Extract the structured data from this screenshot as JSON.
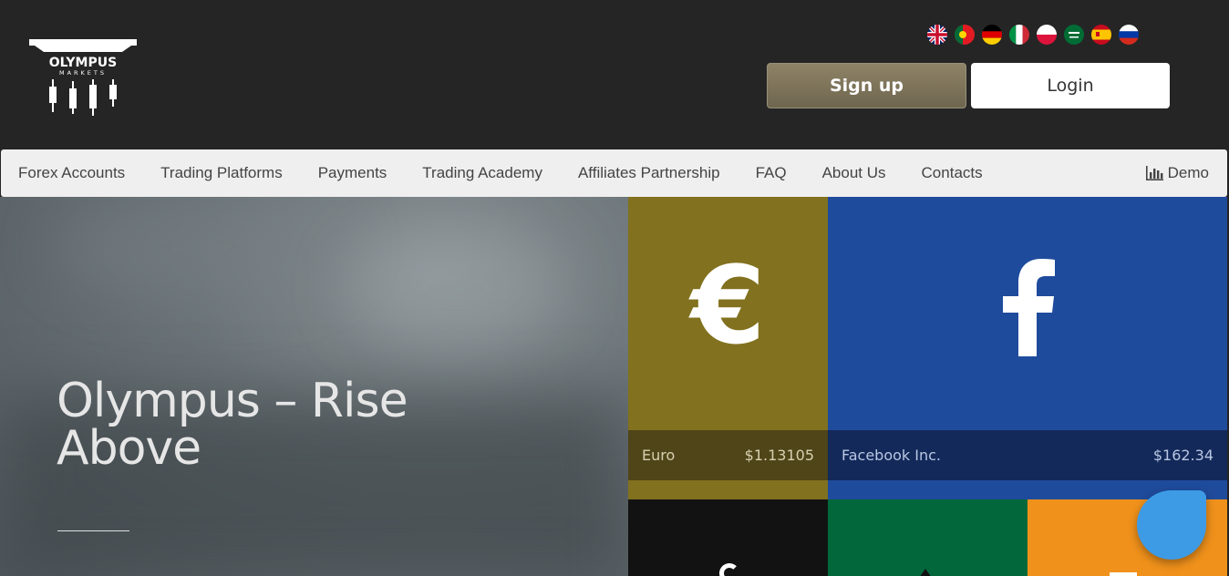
{
  "header": {
    "logo_text": "OLYMPUS",
    "logo_subtext": "MARKETS",
    "flags": [
      "uk-flag-icon",
      "portugal-flag-icon",
      "germany-flag-icon",
      "italy-flag-icon",
      "poland-flag-icon",
      "saudi-arabia-flag-icon",
      "spain-flag-icon",
      "russia-flag-icon"
    ],
    "signup_label": "Sign up",
    "login_label": "Login"
  },
  "nav": {
    "items": [
      {
        "label": "Forex Accounts"
      },
      {
        "label": "Trading Platforms"
      },
      {
        "label": "Payments"
      },
      {
        "label": "Trading Academy"
      },
      {
        "label": "Affiliates Partnership"
      },
      {
        "label": "FAQ"
      },
      {
        "label": "About Us"
      },
      {
        "label": "Contacts"
      }
    ],
    "demo_label": "Demo",
    "demo_icon": "bar-chart-icon"
  },
  "hero": {
    "title": "Olympus – Rise Above"
  },
  "tiles": [
    {
      "name": "Euro",
      "price": "$1.13105",
      "icon": "euro-icon",
      "color": "#82711f"
    },
    {
      "name": "Facebook Inc.",
      "price": "$162.34",
      "icon": "facebook-icon",
      "color": "#1f4b9c"
    }
  ],
  "colors": {
    "header_bg": "#252525",
    "signup_bg": "#7f765c",
    "nav_bg": "#efefef",
    "chat_bubble": "#3d9be6",
    "tile_black": "#121212",
    "tile_green": "#02683c",
    "tile_orange": "#f0911b"
  }
}
